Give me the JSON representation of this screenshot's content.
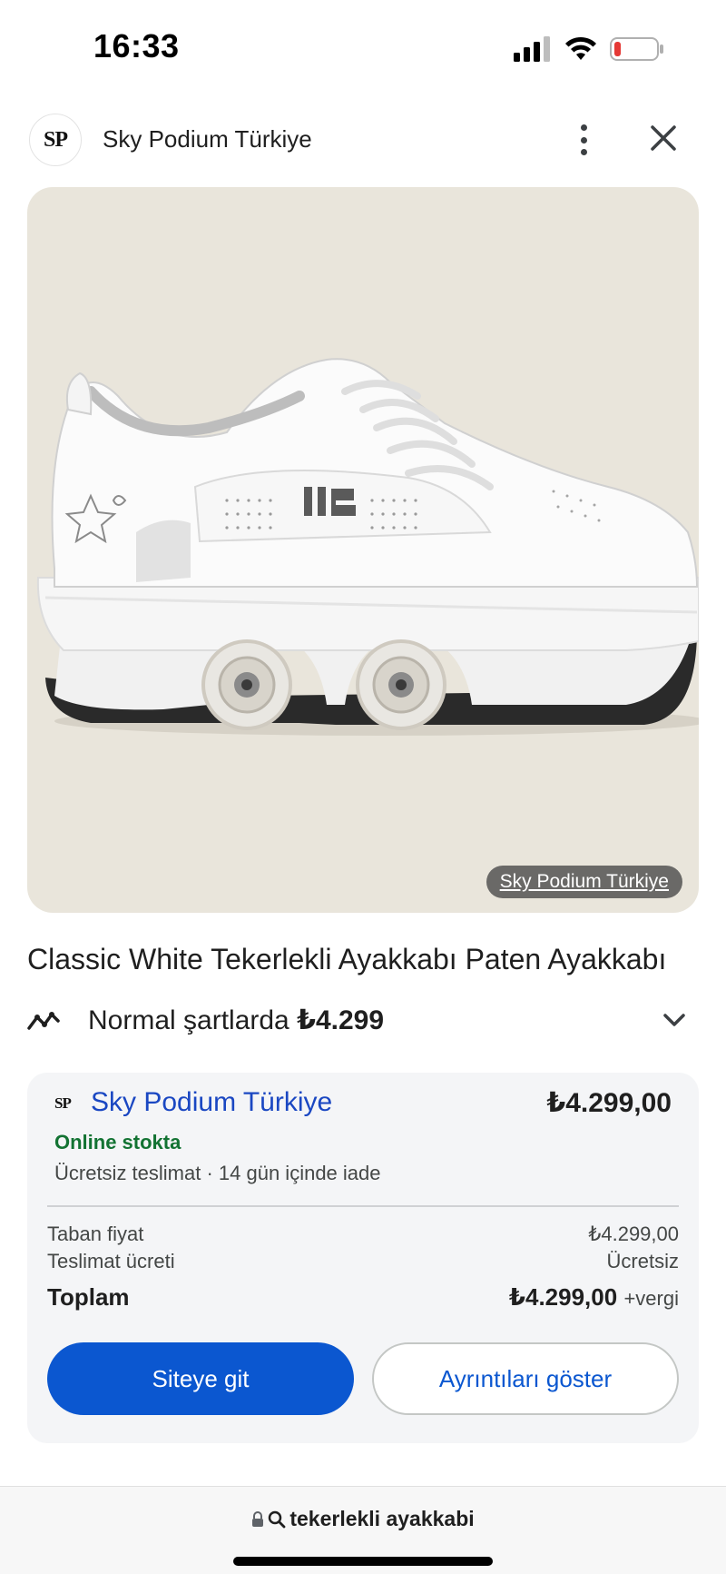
{
  "status_bar": {
    "time": "16:33"
  },
  "header": {
    "logo_text": "SP",
    "title": "Sky Podium Türkiye",
    "icons": [
      "more-vert-icon",
      "close-icon"
    ]
  },
  "image": {
    "source_badge": "Sky Podium Türkiye",
    "background_color": "#e9e5db"
  },
  "product": {
    "title": "Classic White Tekerlekli Ayakkabı Paten Ayakkabı",
    "price_prefix": "Normal şartlarda ",
    "price": "₺4.299"
  },
  "offer": {
    "logo_text": "SP",
    "merchant": "Sky Podium Türkiye",
    "price": "₺4.299,00",
    "stock": "Online stokta",
    "shipping": "Ücretsiz teslimat · 14 gün içinde iade",
    "base_label": "Taban fiyat",
    "base_value": "₺4.299,00",
    "delivery_label": "Teslimat ücreti",
    "delivery_value": "Ücretsiz",
    "total_label": "Toplam",
    "total_value": "₺4.299,00",
    "tax_note": "+vergi",
    "primary_button": "Siteye git",
    "secondary_button": "Ayrıntıları göster"
  },
  "bottom_bar": {
    "url": "tekerlekli ayakkabi"
  },
  "colors": {
    "accent": "#0b57d0",
    "merchant_link": "#1a47c2",
    "in_stock": "#137333",
    "battery_low": "#e53935"
  }
}
